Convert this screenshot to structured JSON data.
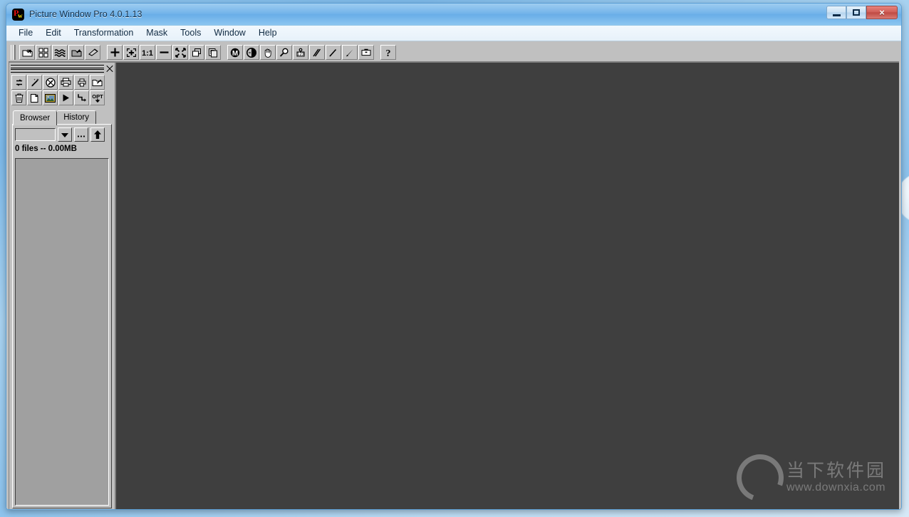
{
  "window": {
    "title": "Picture Window Pro 4.0.1.13",
    "app_icon": "pw-app-icon",
    "icon_letters": {
      "p": "P",
      "w": "w"
    },
    "controls": {
      "minimize": "minimize-button",
      "maximize": "maximize-button",
      "close": "×"
    }
  },
  "menu": {
    "items": [
      {
        "label": "File",
        "name": "menu-file"
      },
      {
        "label": "Edit",
        "name": "menu-edit"
      },
      {
        "label": "Transformation",
        "name": "menu-transformation"
      },
      {
        "label": "Mask",
        "name": "menu-mask"
      },
      {
        "label": "Tools",
        "name": "menu-tools"
      },
      {
        "label": "Window",
        "name": "menu-window"
      },
      {
        "label": "Help",
        "name": "menu-help"
      }
    ]
  },
  "main_toolbar": {
    "buttons": [
      {
        "name": "open-image-icon",
        "title": "Open Image"
      },
      {
        "name": "thumbnails-icon",
        "title": "Thumbnails"
      },
      {
        "name": "waves-icon",
        "title": "Waves"
      },
      {
        "name": "open-mask-icon",
        "title": "Open Mask"
      },
      {
        "name": "flatten-icon",
        "title": "Flatten"
      },
      {
        "name": "crosshair-icon",
        "title": "Crosshair"
      },
      {
        "name": "fit-to-window-icon",
        "title": "Fit To Window"
      },
      {
        "name": "actual-pixels-icon",
        "title": "1:1 Actual Pixels"
      },
      {
        "name": "zoom-out-icon",
        "title": "Zoom Out"
      },
      {
        "name": "shrink-icon",
        "title": "Shrink"
      },
      {
        "name": "tile-windows-icon",
        "title": "Tile Windows"
      },
      {
        "name": "cascade-windows-icon",
        "title": "Cascade Windows"
      },
      {
        "name": "monochrome-icon",
        "title": "Monochrome"
      },
      {
        "name": "brightness-icon",
        "title": "Brightness"
      },
      {
        "name": "hand-pan-icon",
        "title": "Pan"
      },
      {
        "name": "magnifier-icon",
        "title": "Magnify"
      },
      {
        "name": "color-sampler-icon",
        "title": "Color Sampler"
      },
      {
        "name": "line-tool-icon",
        "title": "Line Tool"
      },
      {
        "name": "pencil-icon",
        "title": "Pencil"
      },
      {
        "name": "brush-icon",
        "title": "Brush"
      },
      {
        "name": "toolbox-icon",
        "title": "Toolbox"
      },
      {
        "name": "help-icon",
        "title": "Help",
        "glyph": "?"
      }
    ]
  },
  "browser_panel": {
    "titlebar": {
      "close": "panel-close-icon"
    },
    "tool_rows": [
      [
        {
          "name": "refresh-icon",
          "title": "Refresh"
        },
        {
          "name": "magic-wand-icon",
          "title": "Auto Enhance"
        },
        {
          "name": "no-edit-icon",
          "title": "Disable Edit"
        },
        {
          "name": "print-icon",
          "title": "Print"
        },
        {
          "name": "print-small-icon",
          "title": "Quick Print"
        },
        {
          "name": "export-icon",
          "title": "Export"
        }
      ],
      [
        {
          "name": "trash-icon",
          "title": "Delete"
        },
        {
          "name": "new-file-icon",
          "title": "New"
        },
        {
          "name": "image-preview-icon",
          "title": "Preview"
        },
        {
          "name": "play-icon",
          "title": "Play Slideshow"
        },
        {
          "name": "branch-icon",
          "title": "Batch"
        },
        {
          "name": "options-icon",
          "title": "Options",
          "glyph": "OPT"
        }
      ]
    ],
    "tabs": [
      {
        "label": "Browser",
        "name": "tab-browser",
        "active": true
      },
      {
        "label": "History",
        "name": "tab-history",
        "active": false
      }
    ],
    "path_field": {
      "value": "",
      "placeholder": ""
    },
    "path_buttons": [
      {
        "name": "dropdown-icon",
        "glyph": "▼"
      },
      {
        "name": "browse-folder-icon",
        "glyph": "..."
      },
      {
        "name": "parent-folder-icon",
        "glyph": "↑"
      }
    ],
    "status": "0 files -- 0.00MB"
  },
  "watermark": {
    "cn_text": "当下软件园",
    "url_text": "www.downxia.com"
  },
  "colors": {
    "titlebar_blue": "#74b4ea",
    "chrome_gray": "#c0c0c0",
    "workspace_dark": "#3f3f3f",
    "close_red": "#bf4a43"
  }
}
